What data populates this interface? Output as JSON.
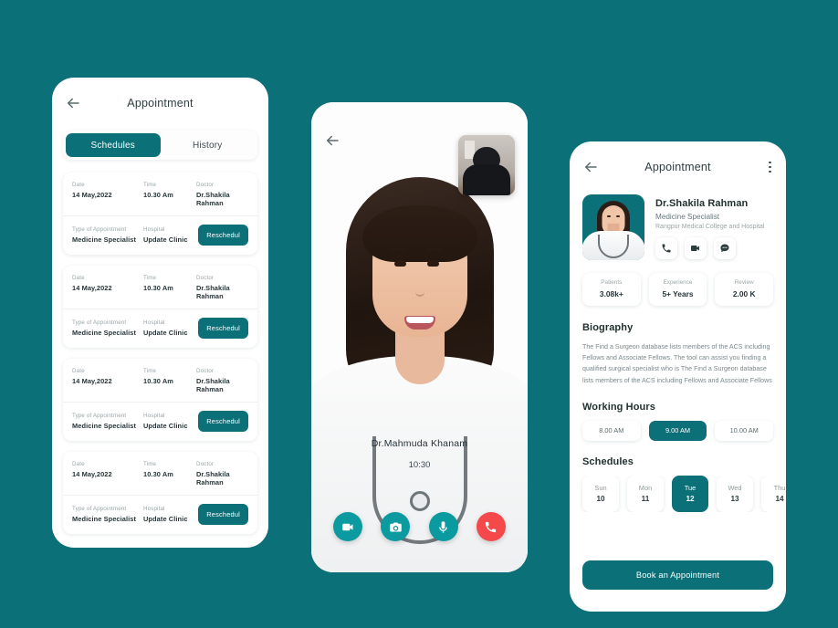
{
  "theme": {
    "background": "#0b7078",
    "primary": "#0b7078",
    "call_accent": "#0b9aa0",
    "danger": "#f4484a"
  },
  "appointments_screen": {
    "back_icon": "arrow-left-icon",
    "title": "Appointment",
    "tabs": [
      {
        "label": "Schedules",
        "active": true
      },
      {
        "label": "History",
        "active": false
      }
    ],
    "labels": {
      "date": "Date",
      "time": "Time",
      "doctor": "Doctor",
      "type": "Type of Appointment",
      "hospital": "Hospital"
    },
    "reschedule_label": "Reschedul",
    "cards": [
      {
        "date": "14 May,2022",
        "time": "10.30 Am",
        "doctor": "Dr.Shakila Rahman",
        "type": "Medicine Specialist",
        "hospital": "Update Clinic"
      },
      {
        "date": "14 May,2022",
        "time": "10.30 Am",
        "doctor": "Dr.Shakila Rahman",
        "type": "Medicine Specialist",
        "hospital": "Update Clinic"
      },
      {
        "date": "14 May,2022",
        "time": "10.30 Am",
        "doctor": "Dr.Shakila Rahman",
        "type": "Medicine Specialist",
        "hospital": "Update Clinic"
      },
      {
        "date": "14 May,2022",
        "time": "10.30 Am",
        "doctor": "Dr.Shakila Rahman",
        "type": "Medicine Specialist",
        "hospital": "Update Clinic"
      }
    ]
  },
  "video_call_screen": {
    "back_icon": "arrow-left-icon",
    "self_view": "self-video-preview",
    "caller_name": "Dr.Mahmuda Khanam",
    "call_duration": "10:30",
    "controls": [
      {
        "name": "video-toggle-button",
        "icon": "video-camera-icon",
        "style": "accent"
      },
      {
        "name": "camera-switch-button",
        "icon": "photo-camera-icon",
        "style": "accent"
      },
      {
        "name": "mute-button",
        "icon": "microphone-icon",
        "style": "accent"
      },
      {
        "name": "end-call-button",
        "icon": "phone-icon",
        "style": "danger"
      }
    ]
  },
  "doctor_detail_screen": {
    "back_icon": "arrow-left-icon",
    "title": "Appointment",
    "menu_icon": "kebab-menu-icon",
    "doctor": {
      "name": "Dr.Shakila Rahman",
      "specialty": "Medicine Specialist",
      "hospital": "Rangpur Medical College and Hospital",
      "avatar": "doctor-avatar"
    },
    "contact_actions": [
      {
        "name": "call-button",
        "icon": "phone-icon"
      },
      {
        "name": "video-call-button",
        "icon": "video-camera-icon"
      },
      {
        "name": "message-button",
        "icon": "chat-bubble-icon"
      }
    ],
    "stats": [
      {
        "label": "Patients",
        "value": "3.08k+"
      },
      {
        "label": "Experience",
        "value": "5+ Years"
      },
      {
        "label": "Review",
        "value": "2.00 K"
      }
    ],
    "biography": {
      "title": "Biography",
      "text": "The Find a Surgeon database lists members of the ACS including Fellows and Associate Fellows. The tool can assist you finding a qualified surgical specialist who is The Find a Surgeon database lists members of the ACS including Fellows and Associate Fellows"
    },
    "working_hours": {
      "title": "Working Hours",
      "slots": [
        {
          "label": "8.00 AM",
          "active": false
        },
        {
          "label": "9.00 AM",
          "active": true
        },
        {
          "label": "10.00 AM",
          "active": false
        }
      ]
    },
    "schedules": {
      "title": "Schedules",
      "days": [
        {
          "name": "Sun",
          "num": "10",
          "active": false
        },
        {
          "name": "Mon",
          "num": "11",
          "active": false
        },
        {
          "name": "Tue",
          "num": "12",
          "active": true
        },
        {
          "name": "Wed",
          "num": "13",
          "active": false
        },
        {
          "name": "Thu",
          "num": "14",
          "active": false
        }
      ]
    },
    "book_button": "Book an Appointment"
  }
}
